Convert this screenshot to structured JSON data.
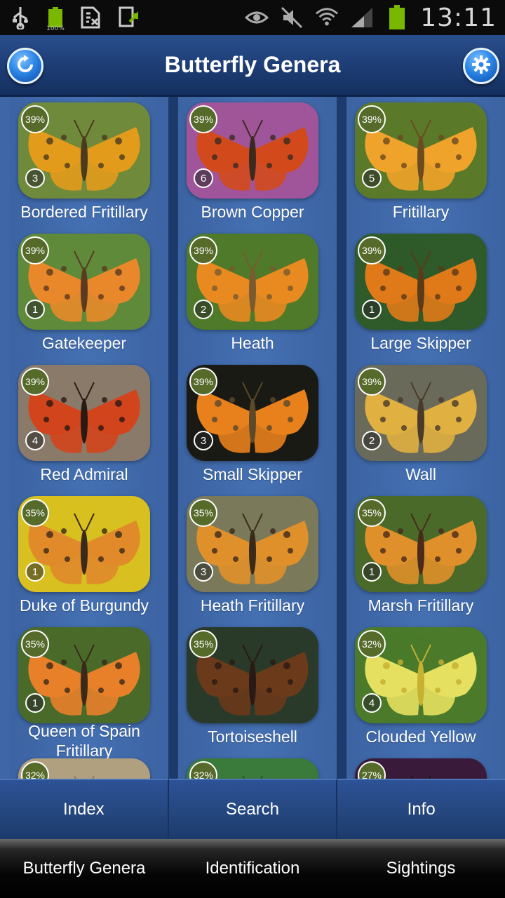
{
  "status_bar": {
    "time": "13:11",
    "battery_small_pct": "100%",
    "icons": [
      "usb-icon",
      "battery-full-icon",
      "sim-icon",
      "download-icon",
      "eye-icon",
      "mute-icon",
      "wifi-icon",
      "signal-icon",
      "battery-icon"
    ]
  },
  "header": {
    "title": "Butterfly Genera",
    "refresh_icon": "refresh-icon",
    "settings_icon": "gear-icon"
  },
  "genera": [
    {
      "name": "Bordered Fritillary",
      "percent": "39%",
      "count": "3"
    },
    {
      "name": "Brown Copper",
      "percent": "39%",
      "count": "6"
    },
    {
      "name": "Fritillary",
      "percent": "39%",
      "count": "5"
    },
    {
      "name": "Gatekeeper",
      "percent": "39%",
      "count": "1"
    },
    {
      "name": "Heath",
      "percent": "39%",
      "count": "2"
    },
    {
      "name": "Large Skipper",
      "percent": "39%",
      "count": "1"
    },
    {
      "name": "Red Admiral",
      "percent": "39%",
      "count": "4"
    },
    {
      "name": "Small Skipper",
      "percent": "39%",
      "count": "3"
    },
    {
      "name": "Wall",
      "percent": "39%",
      "count": "2"
    },
    {
      "name": "Duke of Burgundy",
      "percent": "35%",
      "count": "1"
    },
    {
      "name": "Heath Fritillary",
      "percent": "35%",
      "count": "3"
    },
    {
      "name": "Marsh Fritillary",
      "percent": "35%",
      "count": "1"
    },
    {
      "name": "Queen of Spain Fritillary",
      "percent": "35%",
      "count": "1"
    },
    {
      "name": "Tortoiseshell",
      "percent": "35%",
      "count": ""
    },
    {
      "name": "Clouded Yellow",
      "percent": "32%",
      "count": "4"
    },
    {
      "name": "",
      "percent": "32%",
      "count": ""
    },
    {
      "name": "",
      "percent": "32%",
      "count": ""
    },
    {
      "name": "",
      "percent": "27%",
      "count": ""
    }
  ],
  "colors": {
    "header_blue": "#1f3f78",
    "grid_blue": "#3f66a6",
    "badge_olive": "#566a2a"
  },
  "nav_primary": [
    "Index",
    "Search",
    "Info"
  ],
  "nav_secondary": [
    "Butterfly Genera",
    "Identification",
    "Sightings"
  ]
}
